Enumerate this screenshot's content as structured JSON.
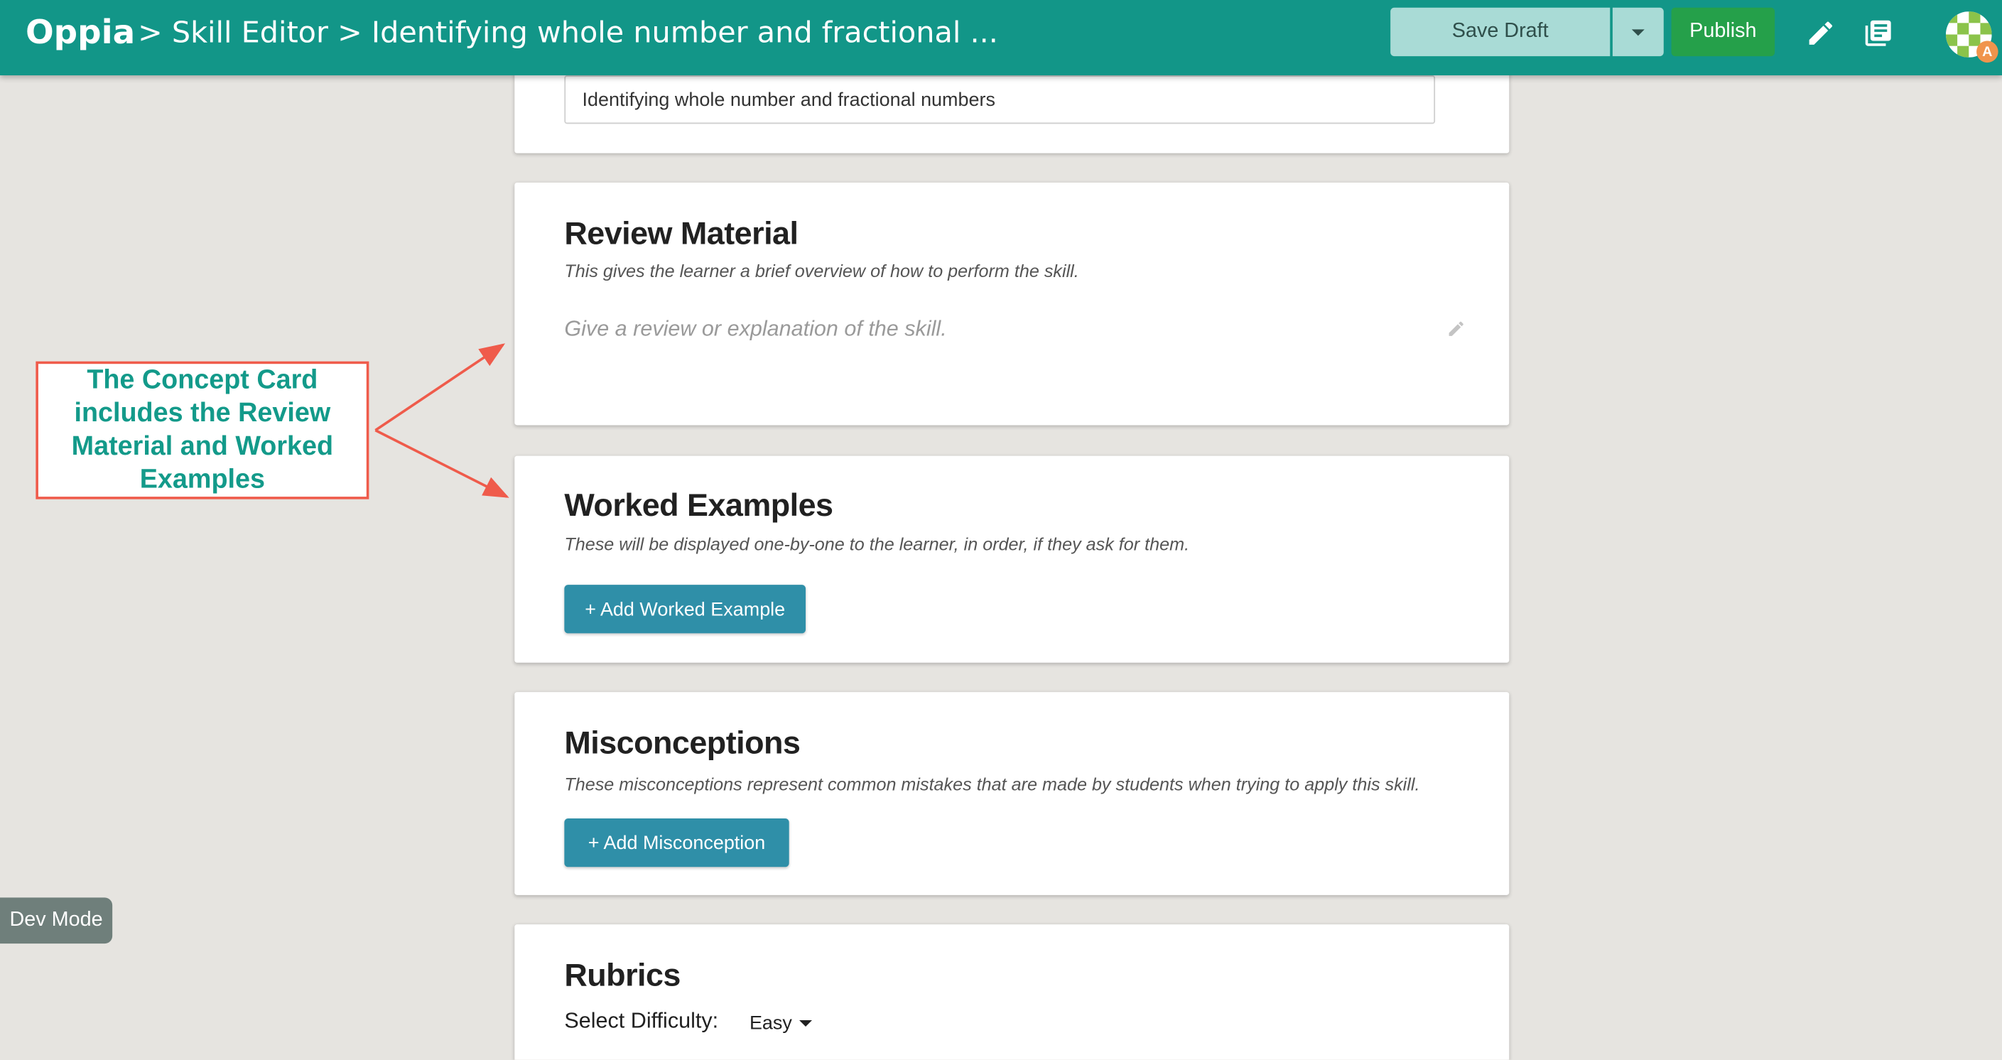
{
  "header": {
    "logo": "Oppia",
    "breadcrumb": "> Skill Editor > Identifying whole number and fractional ...",
    "save_draft_label": "Save Draft",
    "publish_label": "Publish",
    "icons": [
      "caret-down-icon",
      "pencil-icon",
      "preview-icon",
      "avatar-icon"
    ],
    "avatar_badge": "A"
  },
  "skill_description": {
    "value": "Identifying whole number and fractional numbers"
  },
  "review_material": {
    "title": "Review Material",
    "description": "This gives the learner a brief overview of how to perform the skill.",
    "placeholder": "Give a review or explanation of the skill."
  },
  "worked_examples": {
    "title": "Worked Examples",
    "description": "These will be displayed one-by-one to the learner, in order, if they ask for them.",
    "add_label": "+ Add Worked Example"
  },
  "misconceptions": {
    "title": "Misconceptions",
    "description": "These misconceptions represent common mistakes that are made by students when trying to apply this skill.",
    "add_label": "+ Add Misconception"
  },
  "rubrics": {
    "title": "Rubrics",
    "difficulty_label": "Select Difficulty:",
    "difficulty_value": "Easy"
  },
  "annotation": {
    "text": "The Concept Card includes the Review Material and Worked Examples"
  },
  "dev_mode_label": "Dev Mode",
  "colors": {
    "header": "#129688",
    "publish": "#25a04a",
    "save_draft": "#a9dbd6",
    "action_button": "#2f8fa8",
    "annotation_border": "#ef5b4b",
    "annotation_text": "#139a8a",
    "page_background": "#e6e4e0"
  }
}
